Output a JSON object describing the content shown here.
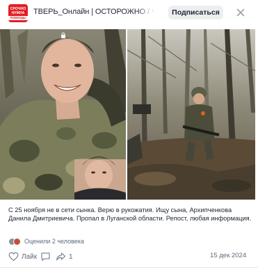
{
  "post": {
    "channel_title": "ТВЕРЬ_Онлайн | ОСТОРОЖНО / ЧП / НУ",
    "avatar_text": [
      "СРОЧНО",
      "НУЖНА",
      "ПОМОЩЬ!"
    ],
    "subscribe_label": "Подписаться",
    "text": "С 25 ноября не в сети сынка. Верю в рукожатия. Ищу сына, Архипченкова Данила Дмитриевича. Пропал в Луганской области. Репост, любая информация.",
    "rated_text": "Оценили 2 человека",
    "like_label": "Лайк",
    "share_count": "1",
    "date": "15 дек 2024"
  },
  "icons": {
    "close": "close-icon",
    "like": "heart-icon",
    "comment": "comment-icon",
    "share": "share-icon",
    "lock": "lock-icon"
  },
  "colors": {
    "subscribe_bg": "#edeef0",
    "meta_text": "#5e6a78",
    "avatar_red": "#e31e24"
  }
}
